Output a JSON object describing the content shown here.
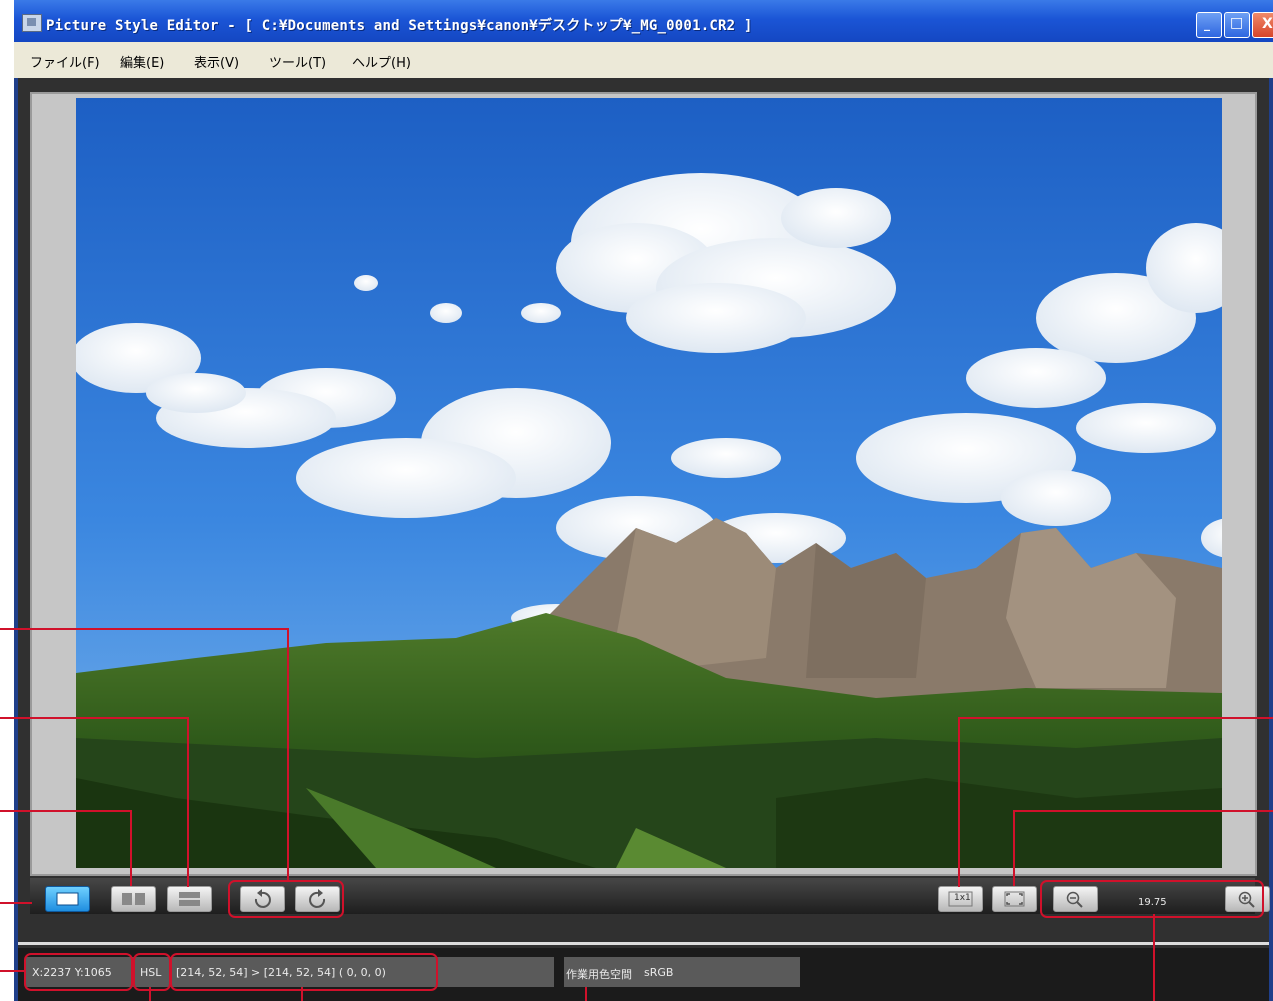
{
  "window": {
    "title": "Picture Style Editor - [ C:¥Documents and Settings¥canon¥デスクトップ¥_MG_0001.CR2 ]",
    "buttons": {
      "minimize": "_",
      "maximize": "□",
      "close": "X"
    }
  },
  "menu": {
    "items": [
      "ファイル(F)",
      "編集(E)",
      "表示(V)",
      "ツール(T)",
      "ヘルプ(H)"
    ]
  },
  "toolbar": {
    "buttons": [
      {
        "name": "single-view",
        "icon": "single-image-icon",
        "active": true
      },
      {
        "name": "side-by-side-view",
        "icon": "side-by-side-icon",
        "active": false
      },
      {
        "name": "top-bottom-view",
        "icon": "top-bottom-icon",
        "active": false
      },
      {
        "name": "rotate-left",
        "icon": "rotate-left-icon",
        "active": false
      },
      {
        "name": "rotate-right",
        "icon": "rotate-right-icon",
        "active": false
      },
      {
        "name": "actual-size",
        "icon": "x1-icon",
        "active": false
      },
      {
        "name": "fit-to-window",
        "icon": "fit-window-icon",
        "active": false
      },
      {
        "name": "zoom-out",
        "icon": "zoom-out-icon",
        "active": false
      },
      {
        "name": "zoom-in",
        "icon": "zoom-in-icon",
        "active": false
      }
    ],
    "actual_size_label": "1x1",
    "zoom_value": "19.75"
  },
  "statusbar": {
    "coordinates": "X:2237 Y:1065",
    "color_mode": "HSL",
    "color_values": "[214, 52, 54] > [214, 52, 54] ( 0, 0, 0)",
    "color_space_label": "作業用色空間",
    "color_space_value": "sRGB"
  },
  "colors": {
    "annotation": "#d0112b",
    "titlebar": "#1b55d6",
    "active_button": "#1f8ee0"
  }
}
